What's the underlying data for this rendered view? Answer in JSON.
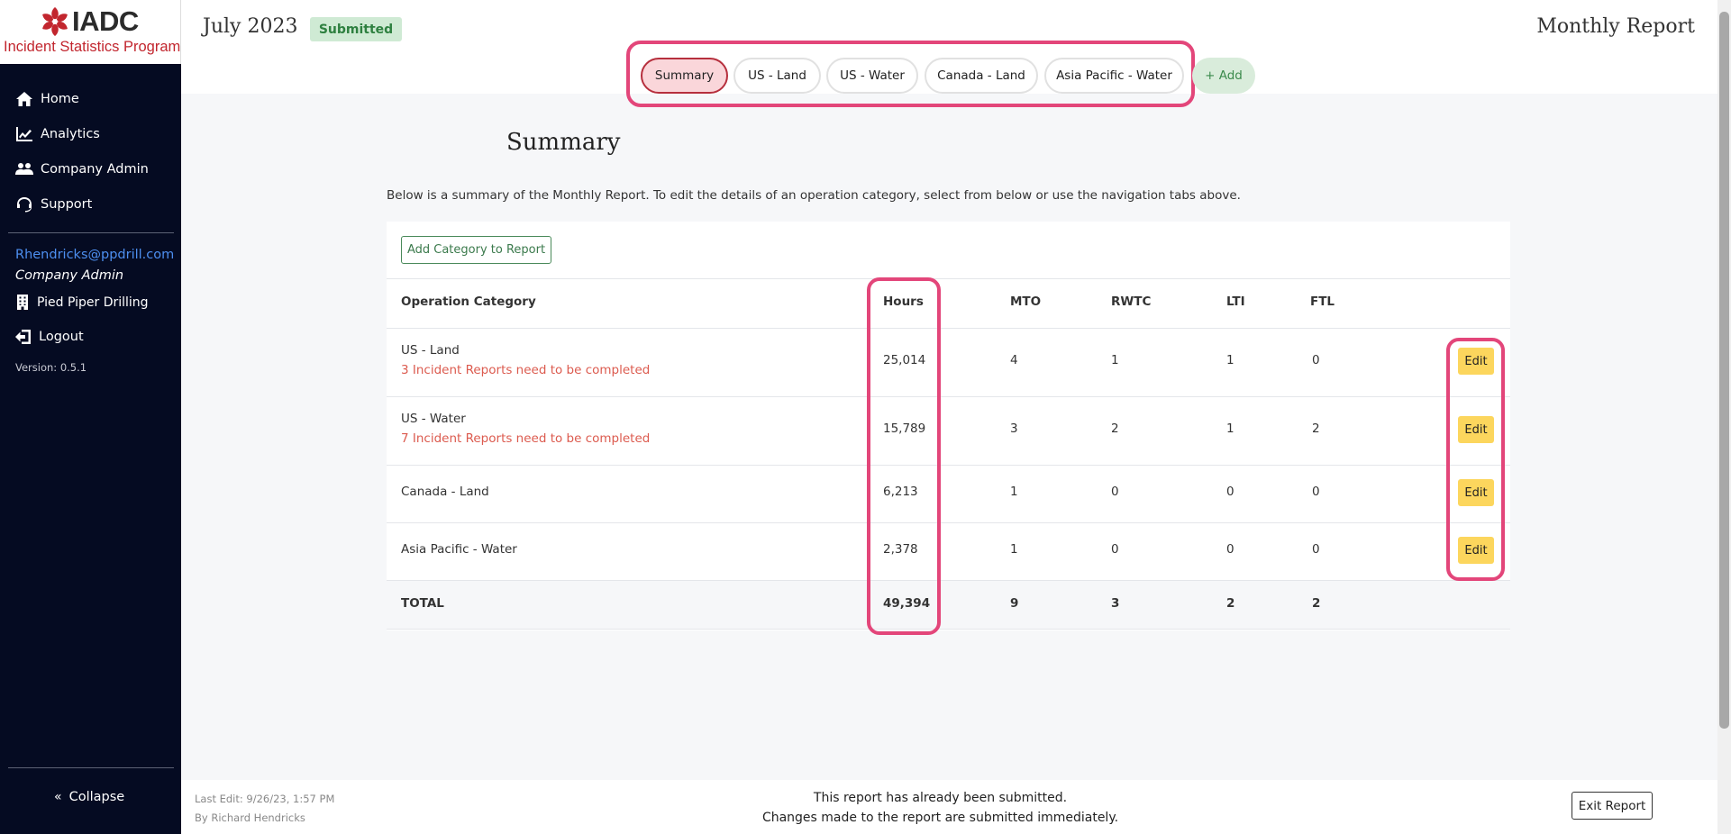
{
  "logo": {
    "word": "IADC",
    "subtitle": "Incident Statistics Program",
    "brand_color": "#c2262e"
  },
  "sidebar": {
    "items": [
      {
        "label": "Home",
        "icon": "home-icon"
      },
      {
        "label": "Analytics",
        "icon": "chart-line-icon"
      },
      {
        "label": "Company Admin",
        "icon": "users-icon"
      },
      {
        "label": "Support",
        "icon": "headset-icon"
      }
    ],
    "user_email": "Rhendricks@ppdrill.com",
    "user_role": "Company Admin",
    "company": "Pied Piper Drilling",
    "logout": "Logout",
    "version": "Version: 0.5.1",
    "collapse": "Collapse"
  },
  "header": {
    "month": "July 2023",
    "status": "Submitted",
    "report_title": "Monthly Report"
  },
  "tabs": [
    {
      "label": "Summary",
      "active": true
    },
    {
      "label": "US - Land",
      "active": false
    },
    {
      "label": "US - Water",
      "active": false
    },
    {
      "label": "Canada - Land",
      "active": false
    },
    {
      "label": "Asia Pacific - Water",
      "active": false
    }
  ],
  "add_tab_label": "+ Add",
  "main": {
    "title": "Summary",
    "description": "Below is a summary of the Monthly Report. To edit the details of an operation category, select from below or use the navigation tabs above.",
    "add_category_label": "Add Category to Report",
    "columns": [
      "Operation Category",
      "Hours",
      "MTO",
      "RWTC",
      "LTI",
      "FTL"
    ],
    "rows": [
      {
        "category": "US - Land",
        "warning": "3 Incident Reports need to be completed",
        "hours": "25,014",
        "mto": "4",
        "rwtc": "1",
        "lti": "1",
        "ftl": "0",
        "edit": "Edit"
      },
      {
        "category": "US - Water",
        "warning": "7 Incident Reports need to be completed",
        "hours": "15,789",
        "mto": "3",
        "rwtc": "2",
        "lti": "1",
        "ftl": "2",
        "edit": "Edit"
      },
      {
        "category": "Canada - Land",
        "warning": "",
        "hours": "6,213",
        "mto": "1",
        "rwtc": "0",
        "lti": "0",
        "ftl": "0",
        "edit": "Edit"
      },
      {
        "category": "Asia Pacific - Water",
        "warning": "",
        "hours": "2,378",
        "mto": "1",
        "rwtc": "0",
        "lti": "0",
        "ftl": "0",
        "edit": "Edit"
      }
    ],
    "total": {
      "label": "TOTAL",
      "hours": "49,394",
      "mto": "9",
      "rwtc": "3",
      "lti": "2",
      "ftl": "2"
    }
  },
  "footer": {
    "last_edit": "Last Edit: 9/26/23, 1:57 PM",
    "edited_by": "By Richard Hendricks",
    "message_line1": "This report has already been submitted.",
    "message_line2": "Changes made to the report are submitted immediately.",
    "exit_label": "Exit Report"
  },
  "colors": {
    "sidebar_bg": "#050b22",
    "highlight": "#e3467a",
    "edit_button": "#fcd65d",
    "warning_text": "#dc5b4f",
    "link": "#4d8ff0"
  }
}
